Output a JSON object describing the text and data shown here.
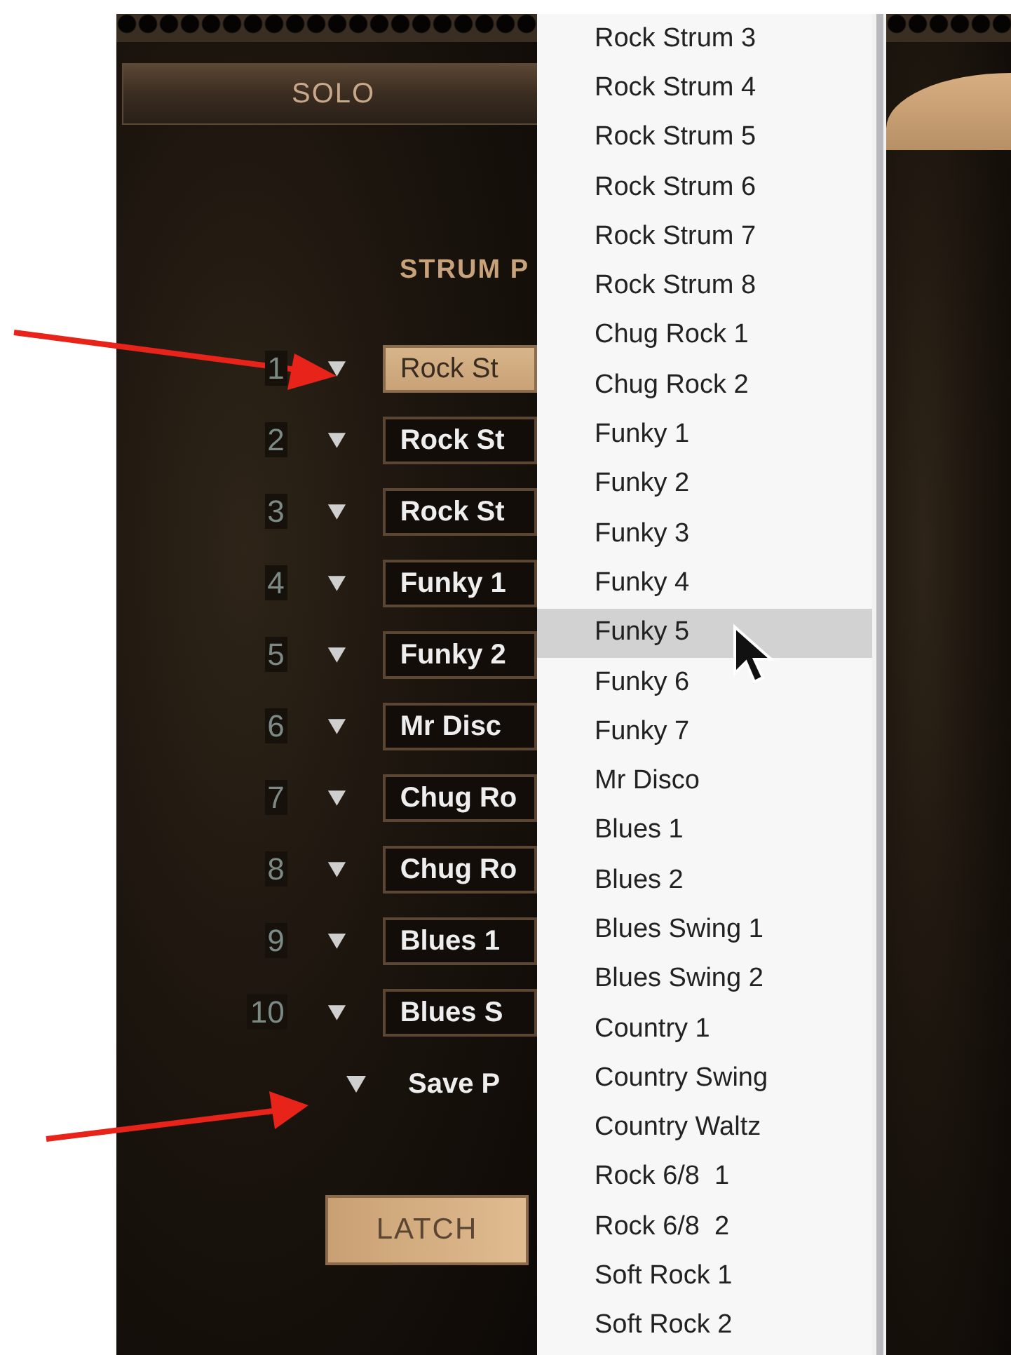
{
  "solo_button": {
    "label": "SOLO"
  },
  "section_title": "STRUM P",
  "slots": [
    {
      "number": "1",
      "pattern": "Rock St",
      "selected": true
    },
    {
      "number": "2",
      "pattern": "Rock St",
      "selected": false
    },
    {
      "number": "3",
      "pattern": "Rock St",
      "selected": false
    },
    {
      "number": "4",
      "pattern": "Funky 1",
      "selected": false
    },
    {
      "number": "5",
      "pattern": "Funky 2",
      "selected": false
    },
    {
      "number": "6",
      "pattern": "Mr Disc",
      "selected": false
    },
    {
      "number": "7",
      "pattern": "Chug Ro",
      "selected": false
    },
    {
      "number": "8",
      "pattern": "Chug Ro",
      "selected": false
    },
    {
      "number": "9",
      "pattern": "Blues 1",
      "selected": false
    },
    {
      "number": "10",
      "pattern": "Blues S",
      "selected": false
    }
  ],
  "save": {
    "label": "Save P"
  },
  "latch_button": {
    "label": "LATCH"
  },
  "menu": {
    "items": [
      {
        "label": "Rock Strum 3",
        "selected": false
      },
      {
        "label": "Rock Strum 4",
        "selected": false
      },
      {
        "label": "Rock Strum 5",
        "selected": false
      },
      {
        "label": "Rock Strum 6",
        "selected": false
      },
      {
        "label": "Rock Strum 7",
        "selected": false
      },
      {
        "label": "Rock Strum 8",
        "selected": false
      },
      {
        "label": "Chug Rock 1",
        "selected": false
      },
      {
        "label": "Chug Rock 2",
        "selected": false
      },
      {
        "label": "Funky 1",
        "selected": false
      },
      {
        "label": "Funky 2",
        "selected": false
      },
      {
        "label": "Funky 3",
        "selected": false
      },
      {
        "label": "Funky 4",
        "selected": false
      },
      {
        "label": "Funky 5",
        "selected": true
      },
      {
        "label": "Funky 6",
        "selected": false
      },
      {
        "label": "Funky 7",
        "selected": false
      },
      {
        "label": "Mr Disco",
        "selected": false
      },
      {
        "label": "Blues 1",
        "selected": false
      },
      {
        "label": "Blues 2",
        "selected": false
      },
      {
        "label": "Blues Swing 1",
        "selected": false
      },
      {
        "label": "Blues Swing 2",
        "selected": false
      },
      {
        "label": "Country 1",
        "selected": false
      },
      {
        "label": "Country Swing",
        "selected": false
      },
      {
        "label": "Country Waltz",
        "selected": false
      },
      {
        "label": "Rock 6/8  1",
        "selected": false
      },
      {
        "label": "Rock 6/8  2",
        "selected": false
      },
      {
        "label": "Soft Rock 1",
        "selected": false
      },
      {
        "label": "Soft Rock 2",
        "selected": false
      }
    ]
  }
}
